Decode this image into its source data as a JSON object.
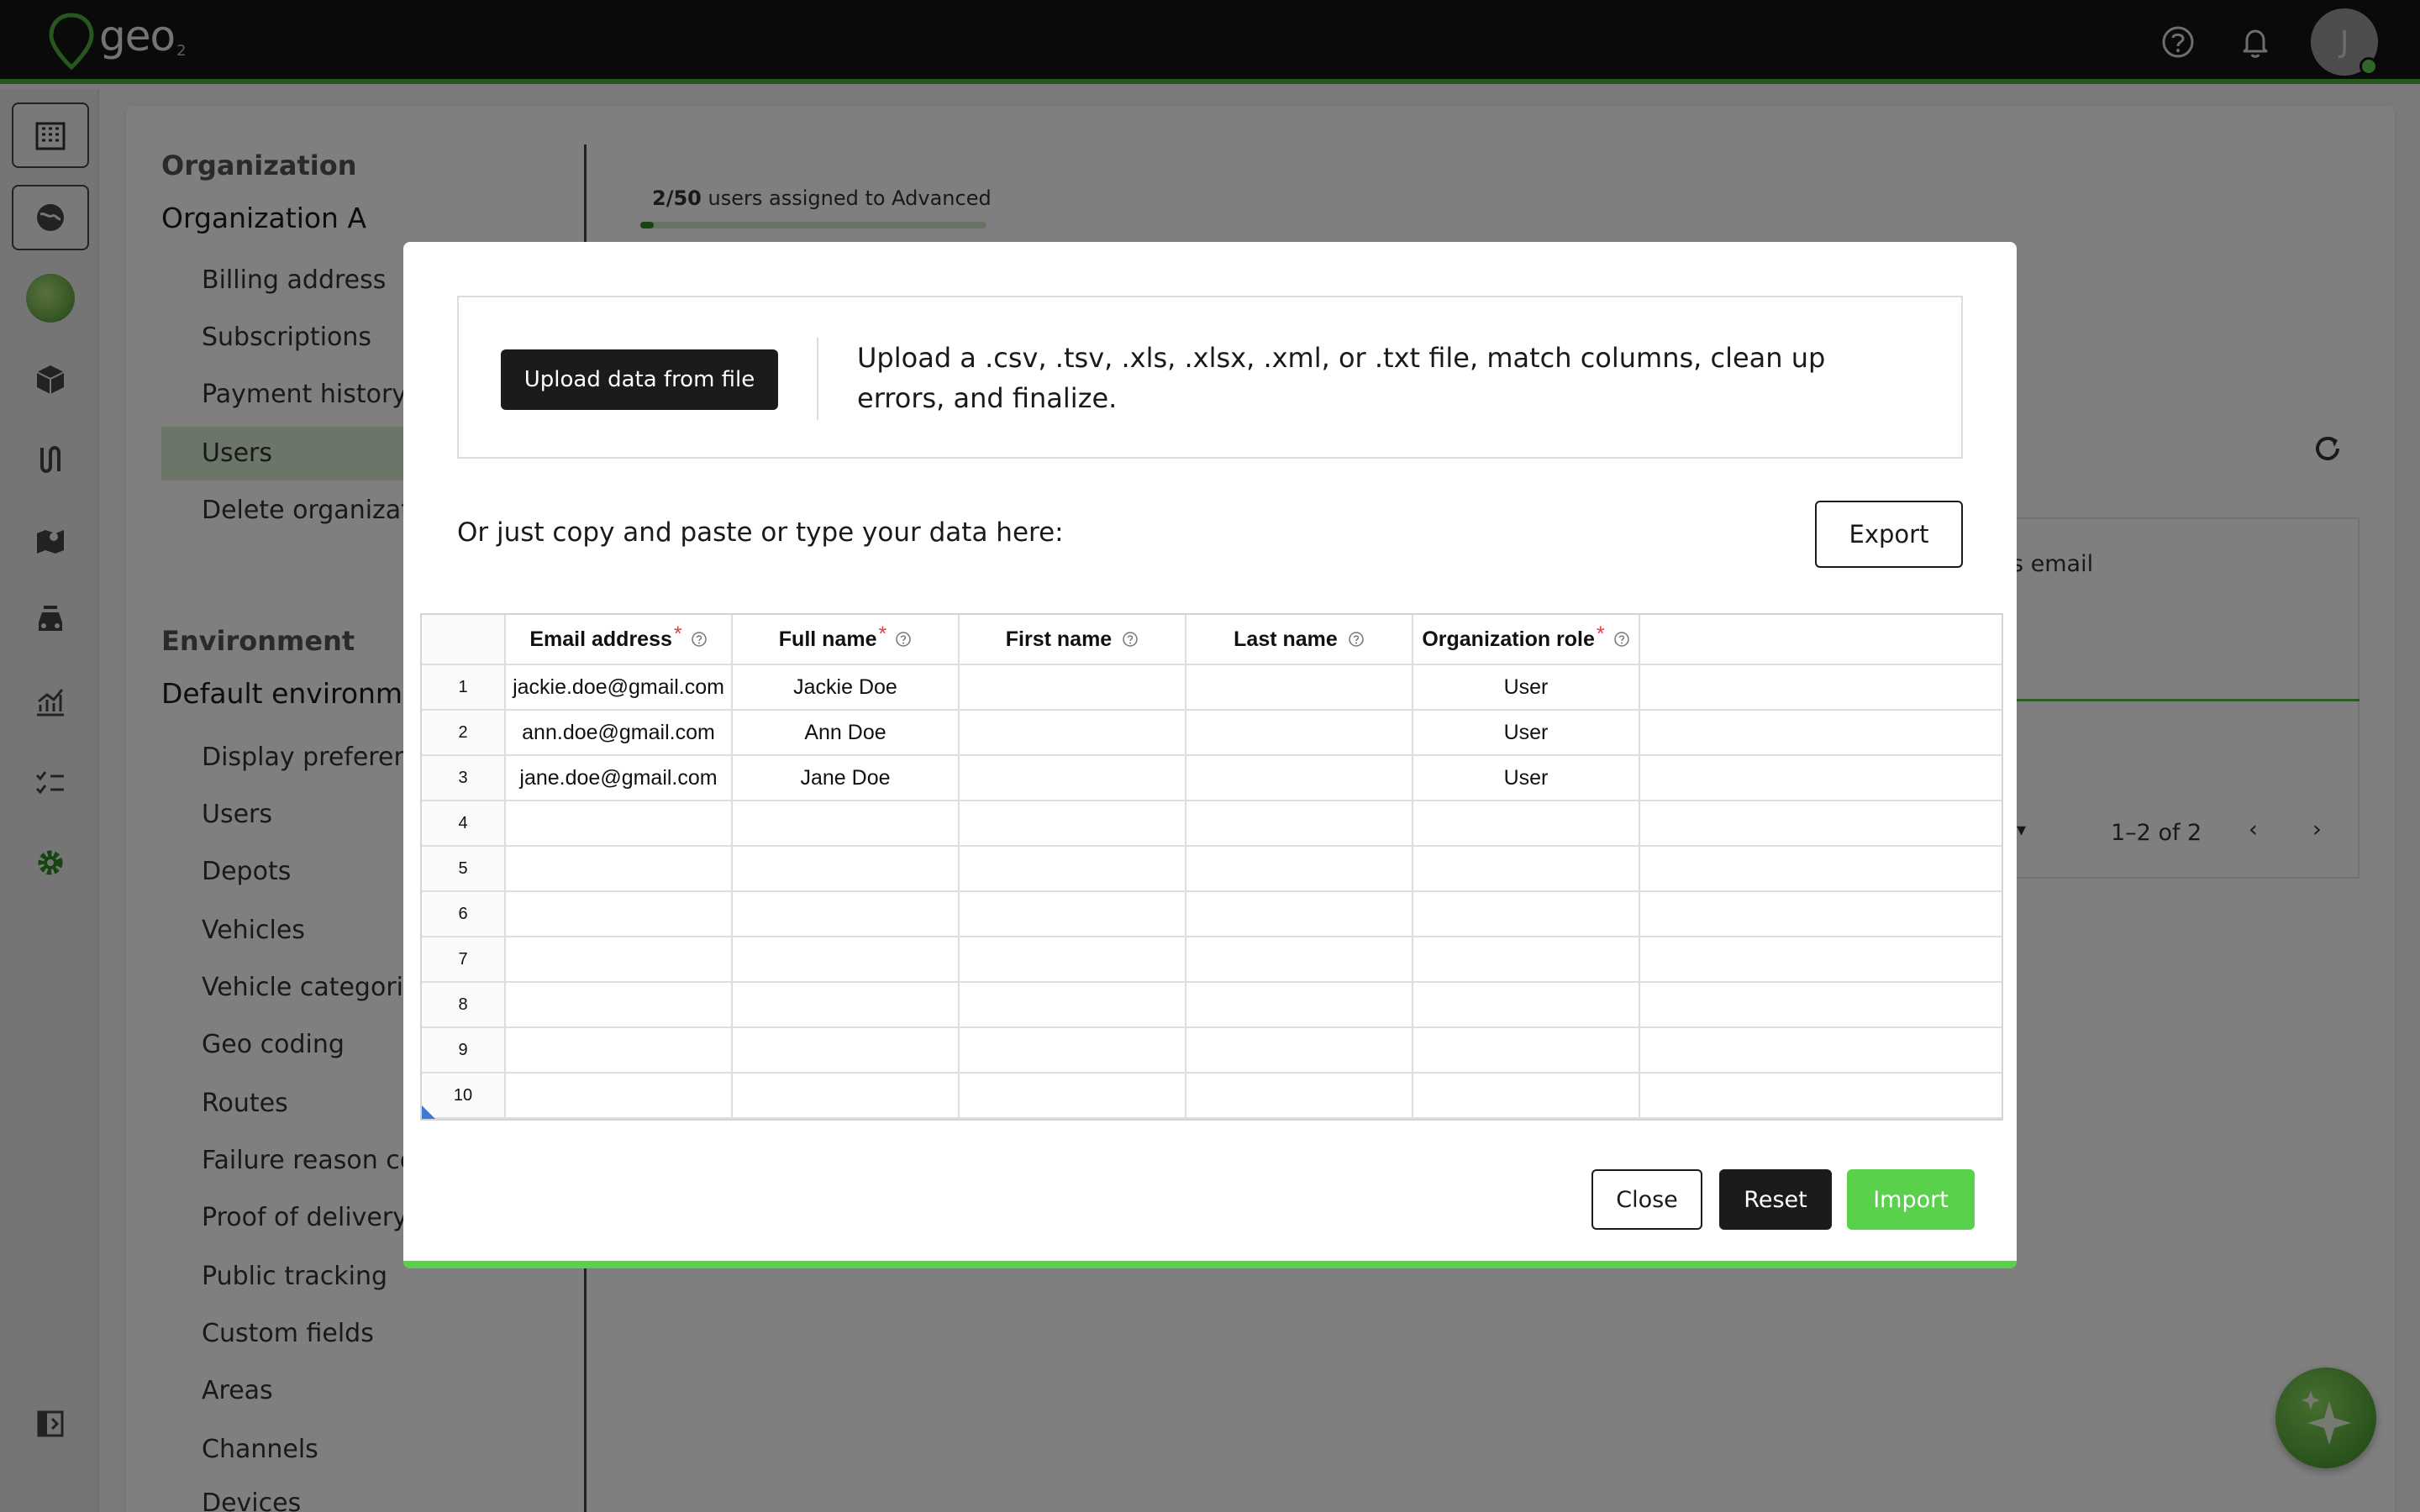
{
  "app": {
    "logo_text": "geo",
    "logo_sub": "2",
    "avatar_initial": "J"
  },
  "colors": {
    "brand_green": "#5ad14a",
    "topbar": "#141414",
    "required_star": "#e04040"
  },
  "topbar_icons": [
    "help-icon",
    "bell-icon"
  ],
  "rail_icons": [
    "building-icon",
    "globe-icon",
    "ai-spark-icon",
    "package-icon",
    "route-icon",
    "map-pin-icon",
    "car-icon",
    "analytics-icon",
    "checklist-icon",
    "gear-icon",
    "collapse-panel-icon"
  ],
  "nav": {
    "org_heading": "Organization",
    "org_name": "Organization A",
    "org_items": [
      "Billing address",
      "Subscriptions",
      "Payment history",
      "Users",
      "Delete organizati"
    ],
    "env_heading": "Environment",
    "env_name": "Default environmen",
    "env_items": [
      "Display preferenc",
      "Users",
      "Depots",
      "Vehicles",
      "Vehicle categorie",
      "Geo coding",
      "Routes",
      "Failure reason co",
      "Proof of delivery",
      "Public tracking",
      "Custom fields",
      "Areas",
      "Channels",
      "Devices"
    ]
  },
  "usage": {
    "count": "2/50",
    "text": " users assigned to Advanced",
    "progress": 0.04
  },
  "background_table": {
    "col_fragment": "s email",
    "pagination": "1–2 of 2"
  },
  "modal": {
    "upload_button": "Upload data from file",
    "upload_description": "Upload a .csv, .tsv, .xls, .xlsx, .xml, or .txt file, match columns, clean up errors, and finalize.",
    "paste_prompt": "Or just copy and paste or type your data here:",
    "export_button": "Export",
    "columns": [
      {
        "label": "Email address",
        "required": "*"
      },
      {
        "label": "Full name",
        "required": "*"
      },
      {
        "label": "First name",
        "required": ""
      },
      {
        "label": "Last name",
        "required": ""
      },
      {
        "label": "Organization role",
        "required": "*"
      }
    ],
    "rows": [
      {
        "num": "1",
        "cells": [
          "jackie.doe@gmail.com",
          "Jackie Doe",
          "",
          "",
          "User",
          ""
        ]
      },
      {
        "num": "2",
        "cells": [
          "ann.doe@gmail.com",
          "Ann Doe",
          "",
          "",
          "User",
          ""
        ]
      },
      {
        "num": "3",
        "cells": [
          "jane.doe@gmail.com",
          "Jane Doe",
          "",
          "",
          "User",
          ""
        ]
      },
      {
        "num": "4",
        "cells": [
          "",
          "",
          "",
          "",
          "",
          ""
        ]
      },
      {
        "num": "5",
        "cells": [
          "",
          "",
          "",
          "",
          "",
          ""
        ]
      },
      {
        "num": "6",
        "cells": [
          "",
          "",
          "",
          "",
          "",
          ""
        ]
      },
      {
        "num": "7",
        "cells": [
          "",
          "",
          "",
          "",
          "",
          ""
        ]
      },
      {
        "num": "8",
        "cells": [
          "",
          "",
          "",
          "",
          "",
          ""
        ]
      },
      {
        "num": "9",
        "cells": [
          "",
          "",
          "",
          "",
          "",
          ""
        ]
      },
      {
        "num": "10",
        "cells": [
          "",
          "",
          "",
          "",
          "",
          ""
        ]
      }
    ],
    "close_button": "Close",
    "reset_button": "Reset",
    "import_button": "Import"
  }
}
